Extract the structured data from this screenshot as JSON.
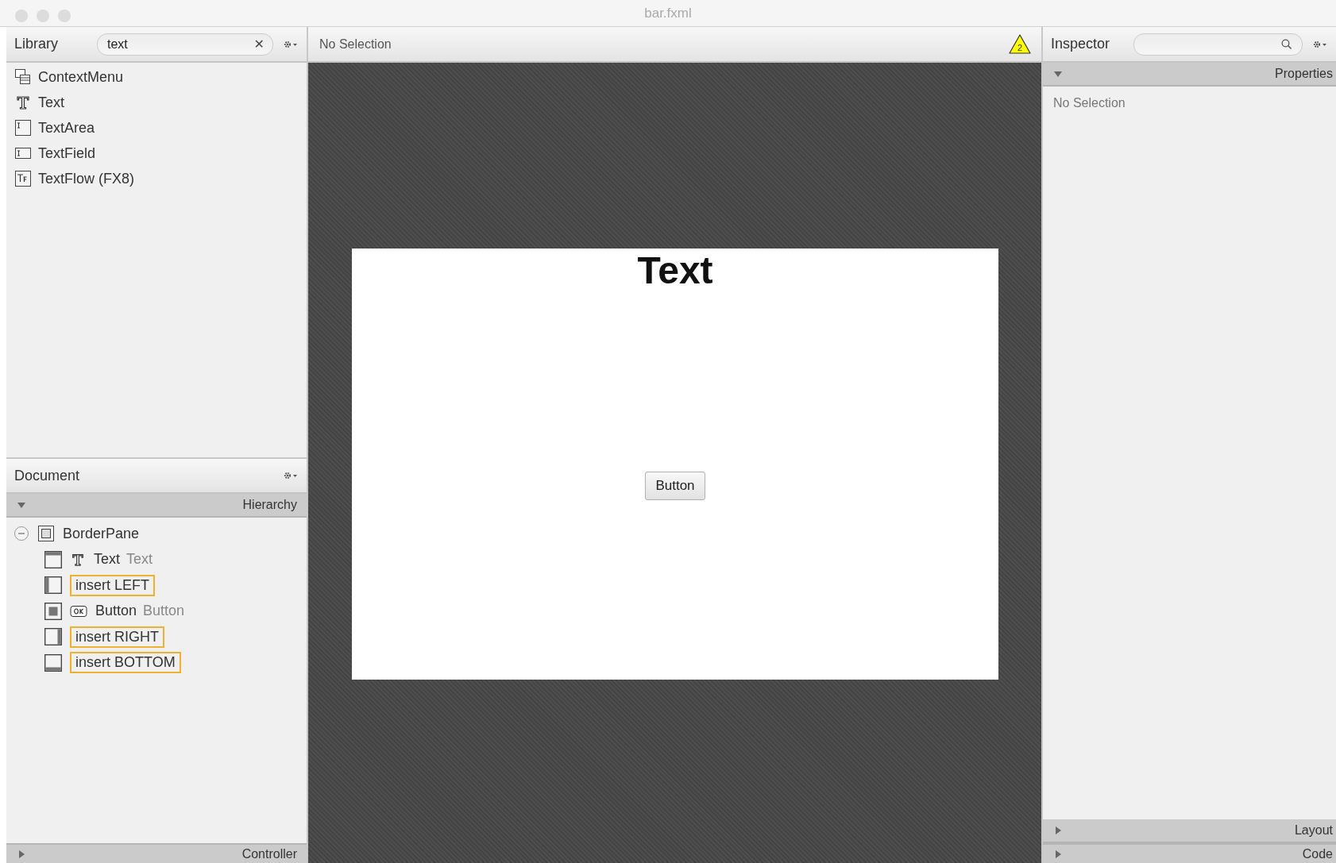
{
  "window": {
    "title": "bar.fxml"
  },
  "library": {
    "title": "Library",
    "search": {
      "value": "text",
      "clear": "✕"
    },
    "items": [
      {
        "label": "ContextMenu",
        "kind": "menu"
      },
      {
        "label": "Text",
        "kind": "text"
      },
      {
        "label": "TextArea",
        "kind": "textarea"
      },
      {
        "label": "TextField",
        "kind": "textfield"
      },
      {
        "label": "TextFlow  (FX8)",
        "kind": "textflow"
      }
    ]
  },
  "document": {
    "title": "Document",
    "hierarchy": {
      "label": "Hierarchy",
      "expanded": true
    },
    "tree": [
      {
        "label": "BorderPane",
        "kind": "container",
        "expanded": true,
        "children": [
          {
            "label": "Text",
            "type": "Text",
            "kind": "text"
          },
          {
            "label": "insert LEFT",
            "kind": "slot"
          },
          {
            "label": "Button",
            "type": "Button",
            "kind": "button"
          },
          {
            "label": "insert RIGHT",
            "kind": "slot"
          },
          {
            "label": "insert BOTTOM",
            "kind": "slot"
          }
        ]
      }
    ],
    "controller": {
      "label": "Controller",
      "expanded": false
    }
  },
  "editor": {
    "status": "No Selection",
    "warnings": "2",
    "canvas": {
      "top_text": "Text",
      "button": "Button"
    }
  },
  "inspector": {
    "title": "Inspector",
    "sections": [
      {
        "label": "Properties",
        "expanded": true,
        "content": "No Selection"
      },
      {
        "label": "Layout",
        "expanded": false
      },
      {
        "label": "Code",
        "expanded": false
      }
    ]
  }
}
